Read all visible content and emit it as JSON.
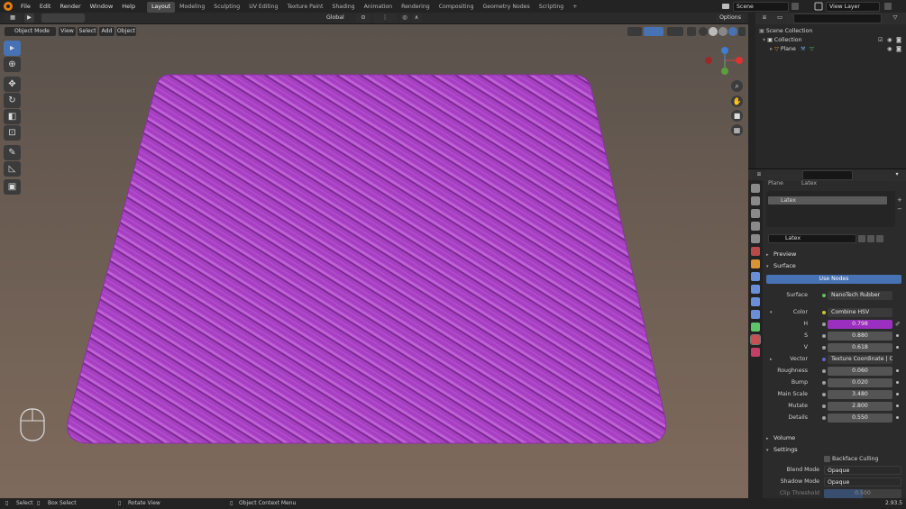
{
  "top_menu": [
    "File",
    "Edit",
    "Render",
    "Window",
    "Help"
  ],
  "workspaces": [
    "Layout",
    "Modeling",
    "Sculpting",
    "UV Editing",
    "Texture Paint",
    "Shading",
    "Animation",
    "Rendering",
    "Compositing",
    "Geometry Nodes",
    "Scripting"
  ],
  "active_workspace": "Layout",
  "add_workspace": "+",
  "scene": {
    "label": "Scene",
    "view_layer": "View Layer"
  },
  "header": {
    "transform_orientation": "Global",
    "options": "Options",
    "mode": "Object Mode",
    "menus": [
      "View",
      "Select",
      "Add",
      "Object"
    ]
  },
  "outliner": {
    "root": "Scene Collection",
    "collection": "Collection",
    "object": "Plane"
  },
  "properties": {
    "breadcrumb_object": "Plane",
    "breadcrumb_material": "Latex",
    "slot_name": "Latex",
    "material_name": "Latex",
    "sections": {
      "preview": "Preview",
      "surface": "Surface",
      "volume": "Volume",
      "settings": "Settings"
    },
    "use_nodes": "Use Nodes",
    "surface_label": "Surface",
    "surface_value": "NanoTech Rubber",
    "color_label": "Color",
    "color_value": "Combine HSV",
    "h_label": "H",
    "h_value": "0.798",
    "s_label": "S",
    "s_value": "0.880",
    "v_label": "V",
    "v_value": "0.618",
    "vector_label": "Vector",
    "vector_value": "Texture Coordinate | Obje...",
    "roughness_label": "Roughness",
    "roughness_value": "0.060",
    "bump_label": "Bump",
    "bump_value": "0.020",
    "main_scale_label": "Main Scale",
    "main_scale_value": "3.480",
    "mutate_label": "Mutate",
    "mutate_value": "2.800",
    "details_label": "Details",
    "details_value": "0.550",
    "backface_culling": "Backface Culling",
    "blend_mode_label": "Blend Mode",
    "blend_mode_value": "Opaque",
    "shadow_mode_label": "Shadow Mode",
    "shadow_mode_value": "Opaque",
    "clip_threshold_label": "Clip Threshold",
    "clip_threshold_value": "0.500"
  },
  "statusbar": {
    "select": "Select",
    "box_select": "Box Select",
    "rotate_view": "Rotate View",
    "context_menu": "Object Context Menu",
    "version": "2.93.5"
  },
  "colors": {
    "accent": "#4772b3",
    "plane": "#a63fc2",
    "hue_field": "#9b2fbf",
    "viewport_bg": "#6a5c52"
  }
}
